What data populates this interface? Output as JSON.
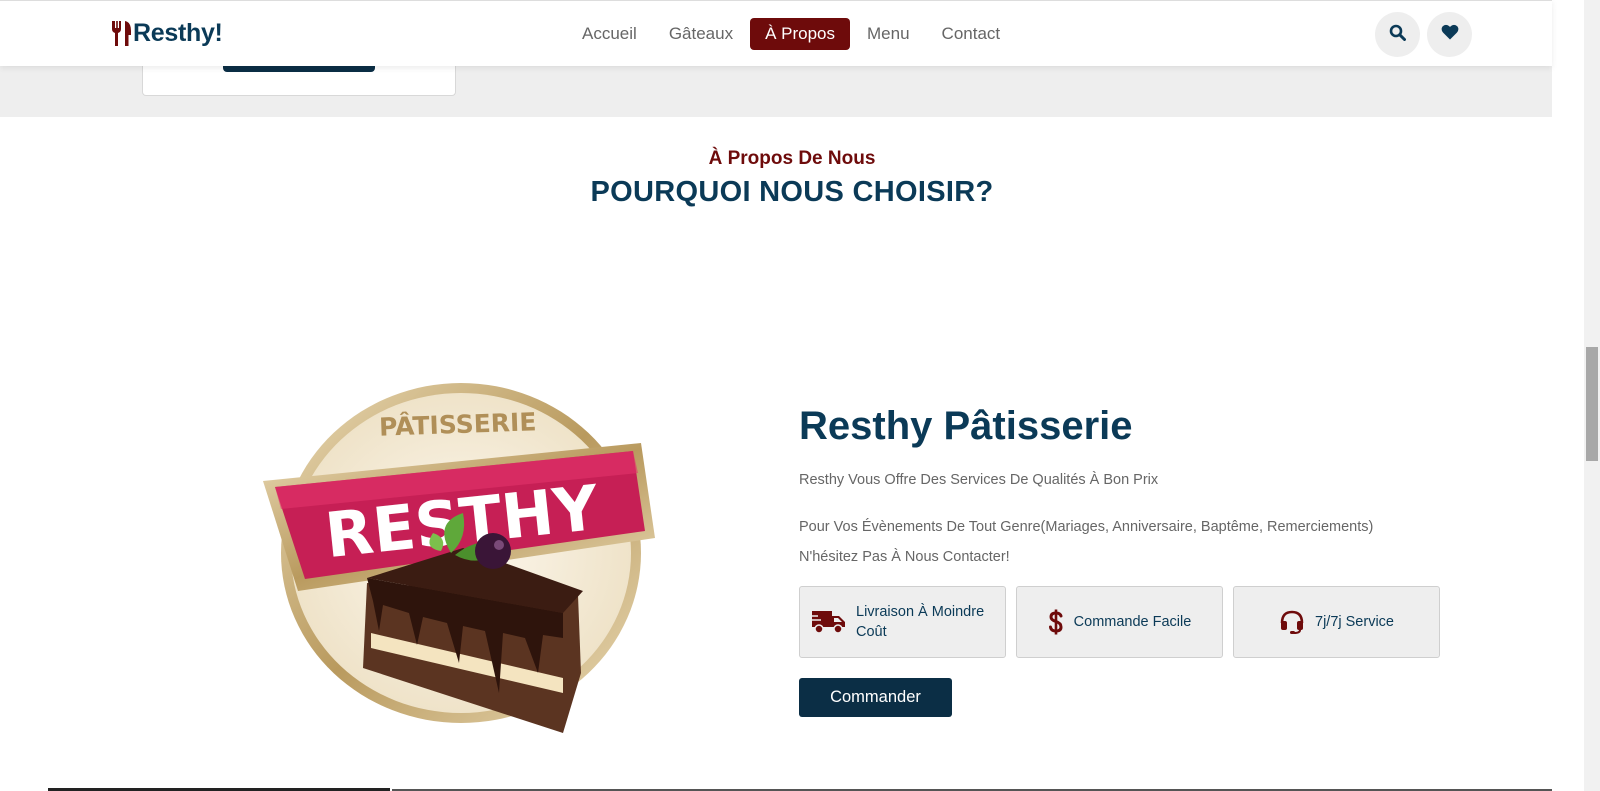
{
  "header": {
    "brand": "Resthy!",
    "nav": [
      {
        "label": "Accueil",
        "active": false
      },
      {
        "label": "Gâteaux",
        "active": false
      },
      {
        "label": "À Propos",
        "active": true
      },
      {
        "label": "Menu",
        "active": false
      },
      {
        "label": "Contact",
        "active": false
      }
    ],
    "icons": [
      "search-icon",
      "heart-icon"
    ]
  },
  "section": {
    "subtitle": "À Propos De Nous",
    "title": "POURQUOI NOUS CHOISIR?"
  },
  "about": {
    "logo_text_top": "PÂTISSERIE",
    "logo_text_main": "RESTHY",
    "title": "Resthy Pâtisserie",
    "paragraph1": "Resthy Vous Offre Des Services De Qualités À Bon Prix",
    "paragraph2_line1": "Pour Vos Évènements De Tout Genre(Mariages, Anniversaire, Baptême, Remerciements)",
    "paragraph2_line2": "N'hésitez Pas À Nous Contacter!",
    "features": [
      {
        "label": "Livraison À Moindre Coût",
        "icon": "truck-icon"
      },
      {
        "label": "Commande Facile",
        "icon": "dollar-icon"
      },
      {
        "label": "7j/7j Service",
        "icon": "headset-icon"
      }
    ],
    "cta": "Commander"
  },
  "colors": {
    "primary": "#0b3a57",
    "accent": "#6e0b0b",
    "button": "#0b2e45",
    "background_light": "#eeeeee"
  }
}
